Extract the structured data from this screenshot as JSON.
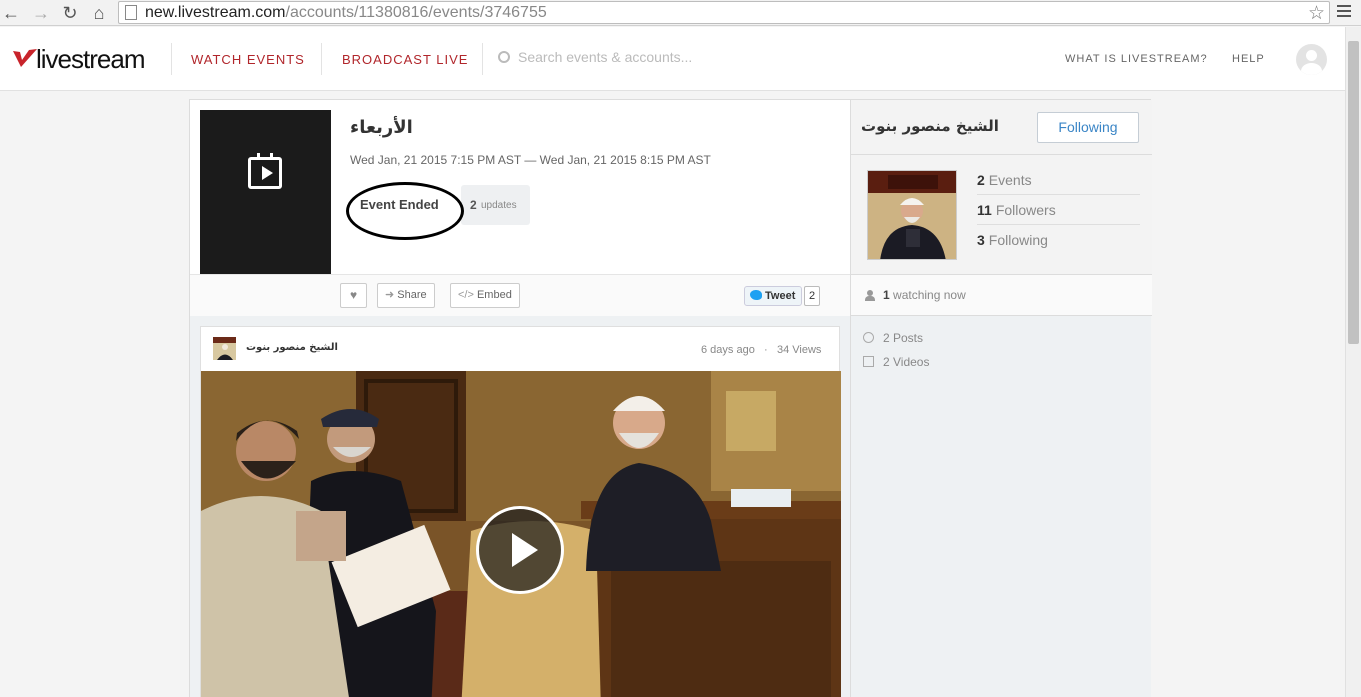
{
  "browser": {
    "url_host": "new.livestream.com",
    "url_path": "/accounts/11380816/events/3746755"
  },
  "header": {
    "logo_text": "livestream",
    "nav": [
      "WATCH EVENTS",
      "BROADCAST LIVE"
    ],
    "search_placeholder": "Search events & accounts...",
    "right_links": [
      "WHAT IS LIVESTREAM?",
      "HELP"
    ],
    "brand_color": "#b1262b"
  },
  "event": {
    "title": "الأربعاء",
    "date_range": "Wed Jan, 21 2015 7:15 PM AST — Wed Jan, 21 2015 8:15 PM AST",
    "status": "Event Ended",
    "updates_count": "2",
    "updates_label": "updates"
  },
  "actions": {
    "share_label": "Share",
    "embed_label": "Embed",
    "tweet_label": "Tweet",
    "tweet_count": "2"
  },
  "account": {
    "name": "الشيخ منصور بنوت",
    "follow_label": "Following",
    "stats": [
      {
        "value": "2",
        "label": "Events"
      },
      {
        "value": "11",
        "label": "Followers"
      },
      {
        "value": "3",
        "label": "Following"
      }
    ],
    "watching_count": "1",
    "watching_label": "watching now",
    "posts": "2 Posts",
    "videos": "2 Videos"
  },
  "post": {
    "author": "الشيخ منصور بنوت",
    "age": "6 days ago",
    "separator": "·",
    "views": "34 Views"
  }
}
